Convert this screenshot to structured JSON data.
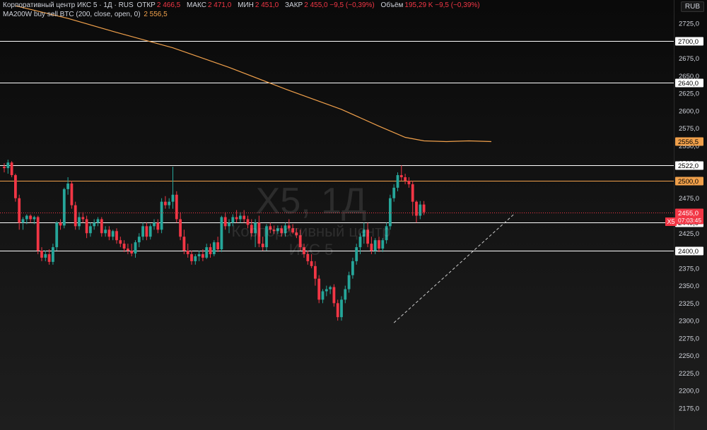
{
  "legend": {
    "title": "Корпоративный центр ИКС 5 · 1Д · RUS",
    "open_label": "ОТКР",
    "open_value": "2 466,5",
    "high_label": "МАКС",
    "high_value": "2 471,0",
    "low_label": "МИН",
    "low_value": "2 451,0",
    "close_label": "ЗАКР",
    "close_value": "2 455,0 −9,5 (−0,39%)",
    "volume_label": "Объём",
    "volume_value": "195,29 K −9,5 (−0,39%)",
    "ma_title": "MA200W buy sell BTC (200, close, open, 0)",
    "ma_value": "2 556,5"
  },
  "currency": "RUB",
  "watermark": {
    "symbol": "X5, 1Д",
    "name": "Корпоративный центр ИКС 5"
  },
  "ticker_tag": "X5",
  "colors": {
    "up": "#26a69a",
    "down": "#f23645",
    "ma": "#f0a04b",
    "level": "#e6e6e6",
    "trend": "#cccccc",
    "background": "#0f0f0f"
  },
  "chart_data": {
    "type": "candlestick",
    "timeframe": "1D",
    "ylim": [
      2165,
      2745
    ],
    "y_ticks": [
      "2725,0",
      "2700,0",
      "2675,0",
      "2650,0",
      "2625,0",
      "2600,0",
      "2575,0",
      "2550,0",
      "2525,0",
      "2500,0",
      "2475,0",
      "2450,0",
      "2425,0",
      "2400,0",
      "2375,0",
      "2350,0",
      "2325,0",
      "2300,0",
      "2275,0",
      "2250,0",
      "2225,0",
      "2200,0",
      "2175,0"
    ],
    "y_tick_values": [
      2725,
      2700,
      2675,
      2650,
      2625,
      2600,
      2575,
      2550,
      2525,
      2500,
      2475,
      2450,
      2425,
      2400,
      2375,
      2350,
      2325,
      2300,
      2275,
      2250,
      2225,
      2200,
      2175
    ],
    "levels": [
      {
        "value": 2700.0,
        "label": "2700,0",
        "color": "#ffffff",
        "text": "#000000"
      },
      {
        "value": 2640.0,
        "label": "2640,0",
        "color": "#ffffff",
        "text": "#000000"
      },
      {
        "value": 2522.0,
        "label": "2522,0",
        "color": "#ffffff",
        "text": "#000000"
      },
      {
        "value": 2500.0,
        "label": "2500,0",
        "color": "#f0a04b",
        "text": "#000000"
      },
      {
        "value": 2440.0,
        "label": "2440,0",
        "color": "#ffffff",
        "text": "#000000"
      },
      {
        "value": 2400.0,
        "label": "2400,0",
        "color": "#ffffff",
        "text": "#000000"
      }
    ],
    "ma_label": {
      "value": 2556.5,
      "label": "2556,5"
    },
    "last_price": {
      "value": 2455.0,
      "label": "2455,0",
      "countdown": "07:03:45"
    },
    "ma_line": [
      {
        "i": 3,
        "v": 2750
      },
      {
        "i": 17,
        "v": 2732
      },
      {
        "i": 30,
        "v": 2712
      },
      {
        "i": 45,
        "v": 2690
      },
      {
        "i": 60,
        "v": 2662
      },
      {
        "i": 75,
        "v": 2631
      },
      {
        "i": 90,
        "v": 2602
      },
      {
        "i": 100,
        "v": 2578
      },
      {
        "i": 107,
        "v": 2562
      },
      {
        "i": 112,
        "v": 2557
      },
      {
        "i": 118,
        "v": 2556
      },
      {
        "i": 124,
        "v": 2557
      },
      {
        "i": 130,
        "v": 2556
      }
    ],
    "trendline": [
      {
        "i": 104,
        "v": 2297
      },
      {
        "i": 136,
        "v": 2452
      }
    ],
    "candles": [
      [
        2520,
        2525,
        2512,
        2518
      ],
      [
        2518,
        2530,
        2510,
        2526
      ],
      [
        2526,
        2528,
        2505,
        2508
      ],
      [
        2508,
        2510,
        2470,
        2475
      ],
      [
        2475,
        2480,
        2430,
        2440
      ],
      [
        2440,
        2448,
        2430,
        2445
      ],
      [
        2445,
        2452,
        2438,
        2450
      ],
      [
        2450,
        2452,
        2440,
        2445
      ],
      [
        2445,
        2450,
        2438,
        2448
      ],
      [
        2448,
        2450,
        2395,
        2400
      ],
      [
        2400,
        2405,
        2385,
        2390
      ],
      [
        2390,
        2400,
        2385,
        2395
      ],
      [
        2395,
        2402,
        2380,
        2384
      ],
      [
        2384,
        2410,
        2380,
        2405
      ],
      [
        2405,
        2442,
        2400,
        2440
      ],
      [
        2440,
        2445,
        2430,
        2436
      ],
      [
        2436,
        2490,
        2432,
        2488
      ],
      [
        2488,
        2505,
        2480,
        2496
      ],
      [
        2496,
        2500,
        2460,
        2465
      ],
      [
        2465,
        2470,
        2430,
        2435
      ],
      [
        2435,
        2455,
        2430,
        2448
      ],
      [
        2448,
        2455,
        2440,
        2445
      ],
      [
        2445,
        2450,
        2418,
        2425
      ],
      [
        2425,
        2440,
        2420,
        2435
      ],
      [
        2435,
        2445,
        2430,
        2440
      ],
      [
        2440,
        2448,
        2435,
        2445
      ],
      [
        2445,
        2448,
        2420,
        2425
      ],
      [
        2425,
        2435,
        2420,
        2430
      ],
      [
        2430,
        2435,
        2415,
        2420
      ],
      [
        2420,
        2430,
        2415,
        2428
      ],
      [
        2428,
        2432,
        2410,
        2415
      ],
      [
        2415,
        2420,
        2405,
        2410
      ],
      [
        2410,
        2415,
        2398,
        2403
      ],
      [
        2403,
        2410,
        2395,
        2400
      ],
      [
        2400,
        2410,
        2392,
        2396
      ],
      [
        2396,
        2415,
        2390,
        2412
      ],
      [
        2412,
        2425,
        2405,
        2420
      ],
      [
        2420,
        2440,
        2415,
        2435
      ],
      [
        2435,
        2440,
        2415,
        2420
      ],
      [
        2420,
        2438,
        2416,
        2435
      ],
      [
        2435,
        2445,
        2430,
        2440
      ],
      [
        2440,
        2445,
        2425,
        2430
      ],
      [
        2430,
        2475,
        2425,
        2470
      ],
      [
        2470,
        2478,
        2460,
        2465
      ],
      [
        2465,
        2475,
        2460,
        2470
      ],
      [
        2470,
        2520,
        2460,
        2480
      ],
      [
        2480,
        2485,
        2440,
        2445
      ],
      [
        2445,
        2455,
        2415,
        2420
      ],
      [
        2420,
        2430,
        2395,
        2400
      ],
      [
        2400,
        2410,
        2390,
        2395
      ],
      [
        2395,
        2400,
        2380,
        2385
      ],
      [
        2385,
        2395,
        2380,
        2392
      ],
      [
        2392,
        2400,
        2385,
        2395
      ],
      [
        2395,
        2402,
        2385,
        2390
      ],
      [
        2390,
        2410,
        2388,
        2405
      ],
      [
        2405,
        2410,
        2390,
        2395
      ],
      [
        2395,
        2415,
        2392,
        2412
      ],
      [
        2412,
        2420,
        2398,
        2402
      ],
      [
        2402,
        2450,
        2398,
        2448
      ],
      [
        2448,
        2455,
        2430,
        2435
      ],
      [
        2435,
        2445,
        2425,
        2440
      ],
      [
        2440,
        2452,
        2435,
        2448
      ],
      [
        2448,
        2458,
        2440,
        2445
      ],
      [
        2445,
        2455,
        2440,
        2450
      ],
      [
        2450,
        2458,
        2440,
        2445
      ],
      [
        2445,
        2450,
        2432,
        2437
      ],
      [
        2437,
        2445,
        2420,
        2425
      ],
      [
        2425,
        2445,
        2405,
        2440
      ],
      [
        2440,
        2450,
        2405,
        2410
      ],
      [
        2410,
        2420,
        2400,
        2405
      ],
      [
        2405,
        2438,
        2400,
        2435
      ],
      [
        2435,
        2440,
        2425,
        2430
      ],
      [
        2430,
        2436,
        2424,
        2428
      ],
      [
        2428,
        2436,
        2424,
        2432
      ],
      [
        2432,
        2436,
        2420,
        2425
      ],
      [
        2425,
        2440,
        2420,
        2436
      ],
      [
        2436,
        2445,
        2428,
        2432
      ],
      [
        2432,
        2438,
        2424,
        2426
      ],
      [
        2426,
        2432,
        2418,
        2422
      ],
      [
        2422,
        2430,
        2400,
        2405
      ],
      [
        2405,
        2410,
        2390,
        2395
      ],
      [
        2395,
        2400,
        2380,
        2385
      ],
      [
        2385,
        2395,
        2375,
        2378
      ],
      [
        2378,
        2385,
        2350,
        2360
      ],
      [
        2360,
        2365,
        2325,
        2330
      ],
      [
        2330,
        2345,
        2325,
        2342
      ],
      [
        2342,
        2350,
        2335,
        2345
      ],
      [
        2345,
        2350,
        2338,
        2348
      ],
      [
        2348,
        2352,
        2320,
        2325
      ],
      [
        2325,
        2330,
        2300,
        2305
      ],
      [
        2305,
        2335,
        2300,
        2330
      ],
      [
        2330,
        2350,
        2325,
        2345
      ],
      [
        2345,
        2370,
        2340,
        2365
      ],
      [
        2365,
        2390,
        2360,
        2385
      ],
      [
        2385,
        2410,
        2380,
        2405
      ],
      [
        2405,
        2425,
        2395,
        2420
      ],
      [
        2420,
        2440,
        2410,
        2430
      ],
      [
        2430,
        2440,
        2405,
        2410
      ],
      [
        2410,
        2420,
        2395,
        2400
      ],
      [
        2400,
        2418,
        2395,
        2415
      ],
      [
        2415,
        2420,
        2398,
        2403
      ],
      [
        2403,
        2418,
        2398,
        2415
      ],
      [
        2415,
        2440,
        2410,
        2435
      ],
      [
        2435,
        2480,
        2430,
        2475
      ],
      [
        2475,
        2495,
        2470,
        2490
      ],
      [
        2490,
        2512,
        2485,
        2508
      ],
      [
        2508,
        2522,
        2500,
        2505
      ],
      [
        2505,
        2510,
        2495,
        2500
      ],
      [
        2500,
        2505,
        2490,
        2495
      ],
      [
        2495,
        2500,
        2450,
        2470
      ],
      [
        2470,
        2472,
        2440,
        2450
      ],
      [
        2450,
        2471,
        2445,
        2466
      ],
      [
        2466,
        2471,
        2451,
        2455
      ]
    ]
  }
}
